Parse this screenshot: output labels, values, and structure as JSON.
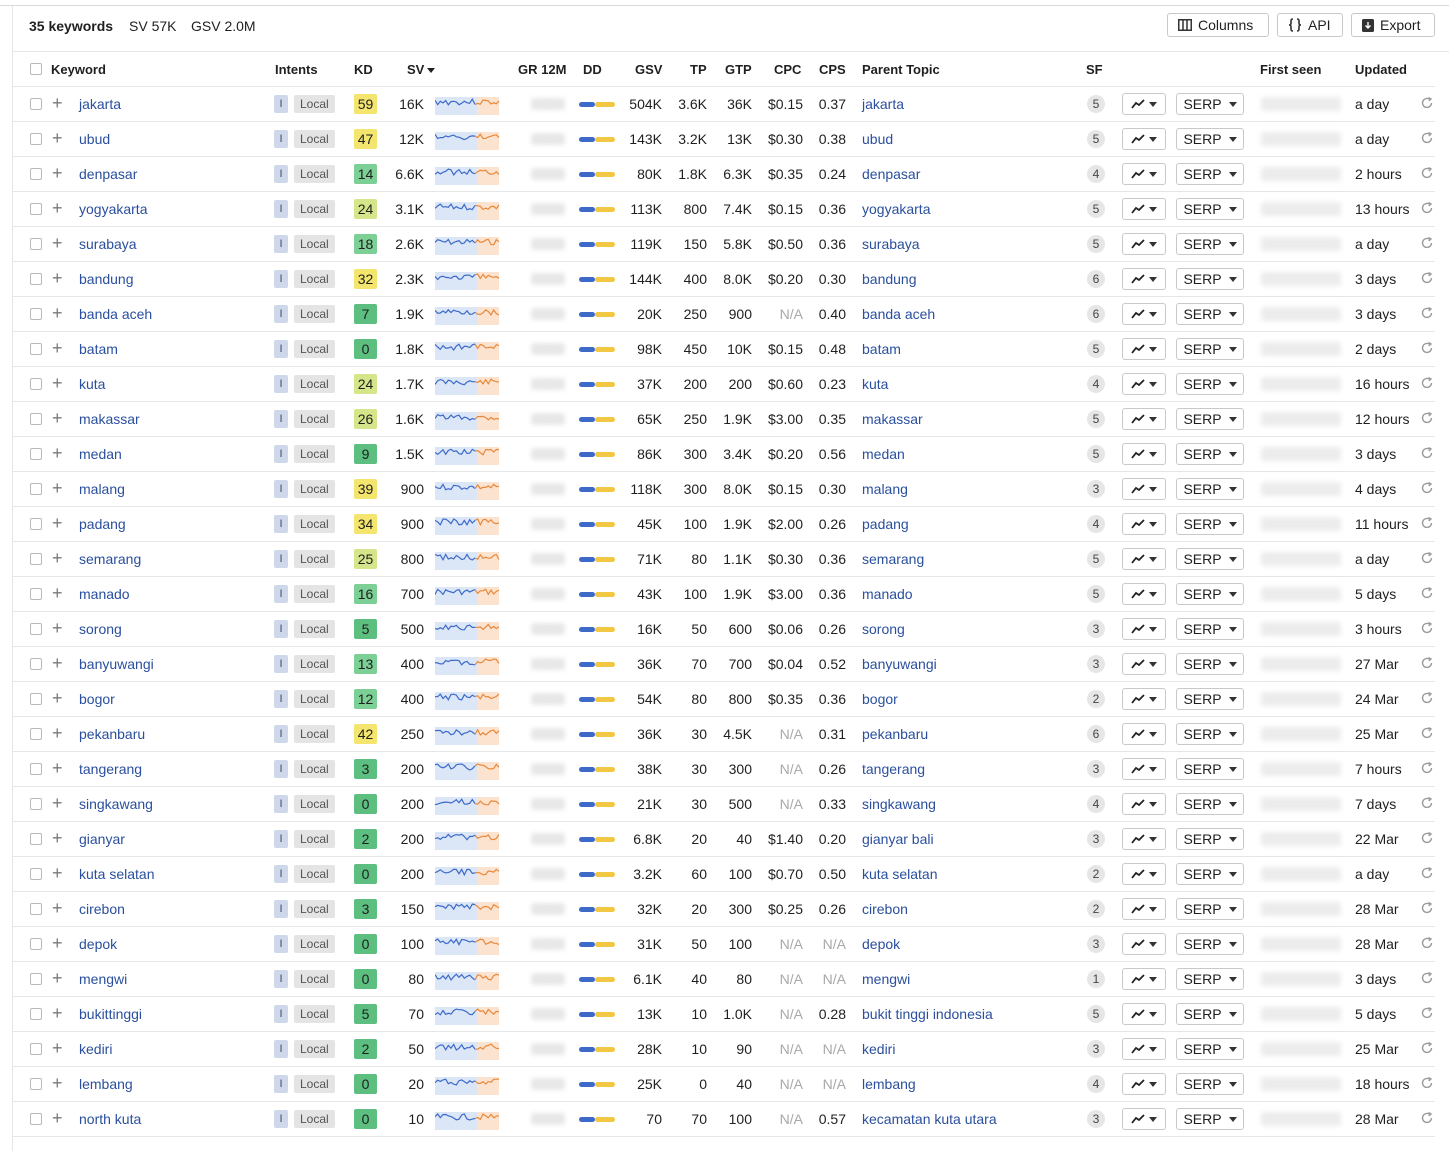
{
  "toolbar": {
    "count": "35 keywords",
    "sv": "SV 57K",
    "gsv": "GSV 2.0M",
    "columns_label": "Columns",
    "api_label": "API",
    "export_label": "Export"
  },
  "columns": {
    "keyword": "Keyword",
    "intents": "Intents",
    "kd": "KD",
    "sv": "SV",
    "gr": "GR 12M",
    "dd": "DD",
    "gsv": "GSV",
    "tp": "TP",
    "gtp": "GTP",
    "cpc": "CPC",
    "cps": "CPS",
    "parent_topic": "Parent Topic",
    "sf": "SF",
    "first_seen": "First seen",
    "updated": "Updated"
  },
  "row_labels": {
    "intent_i": "I",
    "intent_local": "Local",
    "serp": "SERP"
  },
  "colors": {
    "link": "#2a4f9e",
    "kd_yellow": "#f3e56e",
    "kd_lime": "#d5e58a",
    "kd_green": "#7ccf95",
    "kd_green_dark": "#5cbf7f"
  },
  "rows": [
    {
      "keyword": "jakarta",
      "kd": "59",
      "sv": "16K",
      "gsv": "504K",
      "tp": "3.6K",
      "gtp": "36K",
      "cpc": "$0.15",
      "cps": "0.37",
      "parent": "jakarta",
      "sf": "5",
      "updated": "a day"
    },
    {
      "keyword": "ubud",
      "kd": "47",
      "sv": "12K",
      "gsv": "143K",
      "tp": "3.2K",
      "gtp": "13K",
      "cpc": "$0.30",
      "cps": "0.38",
      "parent": "ubud",
      "sf": "5",
      "updated": "a day"
    },
    {
      "keyword": "denpasar",
      "kd": "14",
      "sv": "6.6K",
      "gsv": "80K",
      "tp": "1.8K",
      "gtp": "6.3K",
      "cpc": "$0.35",
      "cps": "0.24",
      "parent": "denpasar",
      "sf": "4",
      "updated": "2 hours"
    },
    {
      "keyword": "yogyakarta",
      "kd": "24",
      "sv": "3.1K",
      "gsv": "113K",
      "tp": "800",
      "gtp": "7.4K",
      "cpc": "$0.15",
      "cps": "0.36",
      "parent": "yogyakarta",
      "sf": "5",
      "updated": "13 hours"
    },
    {
      "keyword": "surabaya",
      "kd": "18",
      "sv": "2.6K",
      "gsv": "119K",
      "tp": "150",
      "gtp": "5.8K",
      "cpc": "$0.50",
      "cps": "0.36",
      "parent": "surabaya",
      "sf": "5",
      "updated": "a day"
    },
    {
      "keyword": "bandung",
      "kd": "32",
      "sv": "2.3K",
      "gsv": "144K",
      "tp": "400",
      "gtp": "8.0K",
      "cpc": "$0.20",
      "cps": "0.30",
      "parent": "bandung",
      "sf": "6",
      "updated": "3 days"
    },
    {
      "keyword": "banda aceh",
      "kd": "7",
      "sv": "1.9K",
      "gsv": "20K",
      "tp": "250",
      "gtp": "900",
      "cpc": "N/A",
      "cps": "0.40",
      "parent": "banda aceh",
      "sf": "6",
      "updated": "3 days"
    },
    {
      "keyword": "batam",
      "kd": "0",
      "sv": "1.8K",
      "gsv": "98K",
      "tp": "450",
      "gtp": "10K",
      "cpc": "$0.15",
      "cps": "0.48",
      "parent": "batam",
      "sf": "5",
      "updated": "2 days"
    },
    {
      "keyword": "kuta",
      "kd": "24",
      "sv": "1.7K",
      "gsv": "37K",
      "tp": "200",
      "gtp": "200",
      "cpc": "$0.60",
      "cps": "0.23",
      "parent": "kuta",
      "sf": "4",
      "updated": "16 hours"
    },
    {
      "keyword": "makassar",
      "kd": "26",
      "sv": "1.6K",
      "gsv": "65K",
      "tp": "250",
      "gtp": "1.9K",
      "cpc": "$3.00",
      "cps": "0.35",
      "parent": "makassar",
      "sf": "5",
      "updated": "12 hours"
    },
    {
      "keyword": "medan",
      "kd": "9",
      "sv": "1.5K",
      "gsv": "86K",
      "tp": "300",
      "gtp": "3.4K",
      "cpc": "$0.20",
      "cps": "0.56",
      "parent": "medan",
      "sf": "5",
      "updated": "3 days"
    },
    {
      "keyword": "malang",
      "kd": "39",
      "sv": "900",
      "gsv": "118K",
      "tp": "300",
      "gtp": "8.0K",
      "cpc": "$0.15",
      "cps": "0.30",
      "parent": "malang",
      "sf": "3",
      "updated": "4 days"
    },
    {
      "keyword": "padang",
      "kd": "34",
      "sv": "900",
      "gsv": "45K",
      "tp": "100",
      "gtp": "1.9K",
      "cpc": "$2.00",
      "cps": "0.26",
      "parent": "padang",
      "sf": "4",
      "updated": "11 hours"
    },
    {
      "keyword": "semarang",
      "kd": "25",
      "sv": "800",
      "gsv": "71K",
      "tp": "80",
      "gtp": "1.1K",
      "cpc": "$0.30",
      "cps": "0.36",
      "parent": "semarang",
      "sf": "5",
      "updated": "a day"
    },
    {
      "keyword": "manado",
      "kd": "16",
      "sv": "700",
      "gsv": "43K",
      "tp": "100",
      "gtp": "1.9K",
      "cpc": "$3.00",
      "cps": "0.36",
      "parent": "manado",
      "sf": "5",
      "updated": "5 days"
    },
    {
      "keyword": "sorong",
      "kd": "5",
      "sv": "500",
      "gsv": "16K",
      "tp": "50",
      "gtp": "600",
      "cpc": "$0.06",
      "cps": "0.26",
      "parent": "sorong",
      "sf": "3",
      "updated": "3 hours"
    },
    {
      "keyword": "banyuwangi",
      "kd": "13",
      "sv": "400",
      "gsv": "36K",
      "tp": "70",
      "gtp": "700",
      "cpc": "$0.04",
      "cps": "0.52",
      "parent": "banyuwangi",
      "sf": "3",
      "updated": "27 Mar"
    },
    {
      "keyword": "bogor",
      "kd": "12",
      "sv": "400",
      "gsv": "54K",
      "tp": "80",
      "gtp": "800",
      "cpc": "$0.35",
      "cps": "0.36",
      "parent": "bogor",
      "sf": "2",
      "updated": "24 Mar"
    },
    {
      "keyword": "pekanbaru",
      "kd": "42",
      "sv": "250",
      "gsv": "36K",
      "tp": "30",
      "gtp": "4.5K",
      "cpc": "N/A",
      "cps": "0.31",
      "parent": "pekanbaru",
      "sf": "6",
      "updated": "25 Mar"
    },
    {
      "keyword": "tangerang",
      "kd": "3",
      "sv": "200",
      "gsv": "38K",
      "tp": "30",
      "gtp": "300",
      "cpc": "N/A",
      "cps": "0.26",
      "parent": "tangerang",
      "sf": "3",
      "updated": "7 hours"
    },
    {
      "keyword": "singkawang",
      "kd": "0",
      "sv": "200",
      "gsv": "21K",
      "tp": "30",
      "gtp": "500",
      "cpc": "N/A",
      "cps": "0.33",
      "parent": "singkawang",
      "sf": "4",
      "updated": "7 days"
    },
    {
      "keyword": "gianyar",
      "kd": "2",
      "sv": "200",
      "gsv": "6.8K",
      "tp": "20",
      "gtp": "40",
      "cpc": "$1.40",
      "cps": "0.20",
      "parent": "gianyar bali",
      "sf": "3",
      "updated": "22 Mar"
    },
    {
      "keyword": "kuta selatan",
      "kd": "0",
      "sv": "200",
      "gsv": "3.2K",
      "tp": "60",
      "gtp": "100",
      "cpc": "$0.70",
      "cps": "0.50",
      "parent": "kuta selatan",
      "sf": "2",
      "updated": "a day"
    },
    {
      "keyword": "cirebon",
      "kd": "3",
      "sv": "150",
      "gsv": "32K",
      "tp": "20",
      "gtp": "300",
      "cpc": "$0.25",
      "cps": "0.26",
      "parent": "cirebon",
      "sf": "2",
      "updated": "28 Mar"
    },
    {
      "keyword": "depok",
      "kd": "0",
      "sv": "100",
      "gsv": "31K",
      "tp": "50",
      "gtp": "100",
      "cpc": "N/A",
      "cps": "N/A",
      "parent": "depok",
      "sf": "3",
      "updated": "28 Mar"
    },
    {
      "keyword": "mengwi",
      "kd": "0",
      "sv": "80",
      "gsv": "6.1K",
      "tp": "40",
      "gtp": "80",
      "cpc": "N/A",
      "cps": "N/A",
      "parent": "mengwi",
      "sf": "1",
      "updated": "3 days"
    },
    {
      "keyword": "bukittinggi",
      "kd": "5",
      "sv": "70",
      "gsv": "13K",
      "tp": "10",
      "gtp": "1.0K",
      "cpc": "N/A",
      "cps": "0.28",
      "parent": "bukit tinggi indonesia",
      "sf": "5",
      "updated": "5 days"
    },
    {
      "keyword": "kediri",
      "kd": "2",
      "sv": "50",
      "gsv": "28K",
      "tp": "10",
      "gtp": "90",
      "cpc": "N/A",
      "cps": "N/A",
      "parent": "kediri",
      "sf": "3",
      "updated": "25 Mar"
    },
    {
      "keyword": "lembang",
      "kd": "0",
      "sv": "20",
      "gsv": "25K",
      "tp": "0",
      "gtp": "40",
      "cpc": "N/A",
      "cps": "N/A",
      "parent": "lembang",
      "sf": "4",
      "updated": "18 hours"
    },
    {
      "keyword": "north kuta",
      "kd": "0",
      "sv": "10",
      "gsv": "70",
      "tp": "70",
      "gtp": "100",
      "cpc": "N/A",
      "cps": "0.57",
      "parent": "kecamatan kuta utara",
      "sf": "3",
      "updated": "28 Mar"
    }
  ]
}
